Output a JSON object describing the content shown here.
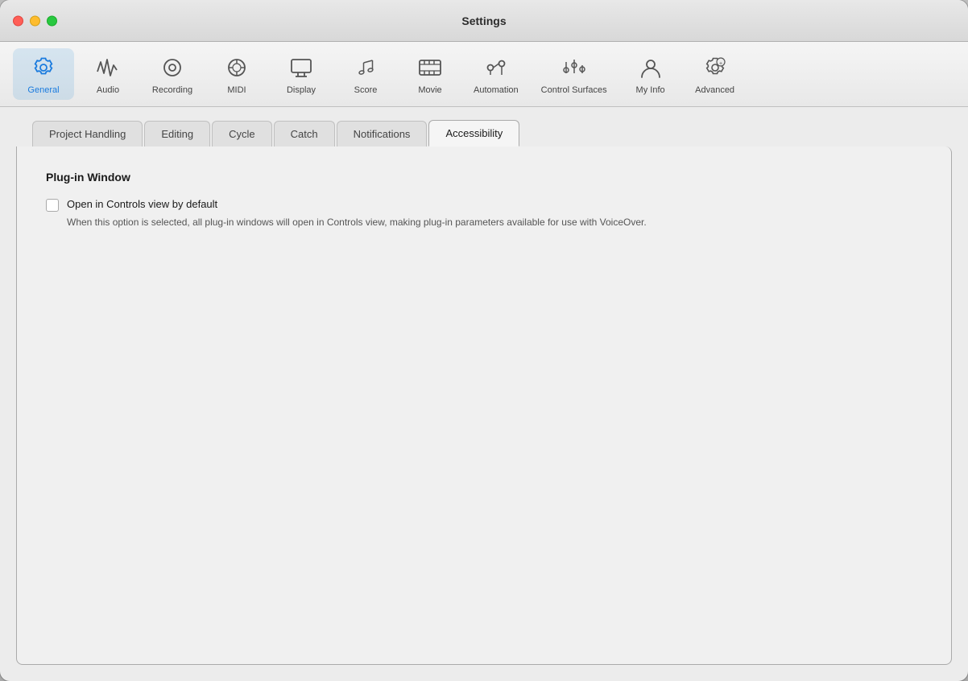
{
  "window": {
    "title": "Settings"
  },
  "toolbar": {
    "items": [
      {
        "id": "general",
        "label": "General",
        "icon": "gear-icon",
        "active": true
      },
      {
        "id": "audio",
        "label": "Audio",
        "icon": "audio-icon",
        "active": false
      },
      {
        "id": "recording",
        "label": "Recording",
        "icon": "recording-icon",
        "active": false
      },
      {
        "id": "midi",
        "label": "MIDI",
        "icon": "midi-icon",
        "active": false
      },
      {
        "id": "display",
        "label": "Display",
        "icon": "display-icon",
        "active": false
      },
      {
        "id": "score",
        "label": "Score",
        "icon": "score-icon",
        "active": false
      },
      {
        "id": "movie",
        "label": "Movie",
        "icon": "movie-icon",
        "active": false
      },
      {
        "id": "automation",
        "label": "Automation",
        "icon": "automation-icon",
        "active": false
      },
      {
        "id": "control-surfaces",
        "label": "Control Surfaces",
        "icon": "control-surfaces-icon",
        "active": false
      },
      {
        "id": "my-info",
        "label": "My Info",
        "icon": "my-info-icon",
        "active": false
      },
      {
        "id": "advanced",
        "label": "Advanced",
        "icon": "advanced-icon",
        "active": false
      }
    ]
  },
  "tabs": [
    {
      "id": "project-handling",
      "label": "Project Handling",
      "active": false
    },
    {
      "id": "editing",
      "label": "Editing",
      "active": false
    },
    {
      "id": "cycle",
      "label": "Cycle",
      "active": false
    },
    {
      "id": "catch",
      "label": "Catch",
      "active": false
    },
    {
      "id": "notifications",
      "label": "Notifications",
      "active": false
    },
    {
      "id": "accessibility",
      "label": "Accessibility",
      "active": true
    }
  ],
  "content": {
    "section_title": "Plug-in Window",
    "options": [
      {
        "id": "open-controls-view",
        "label": "Open in Controls view by default",
        "description": "When this option is selected, all plug-in windows will open in Controls view, making plug-in parameters available for use with VoiceOver.",
        "checked": false
      }
    ]
  },
  "traffic_lights": {
    "close": "close",
    "minimize": "minimize",
    "maximize": "maximize"
  }
}
